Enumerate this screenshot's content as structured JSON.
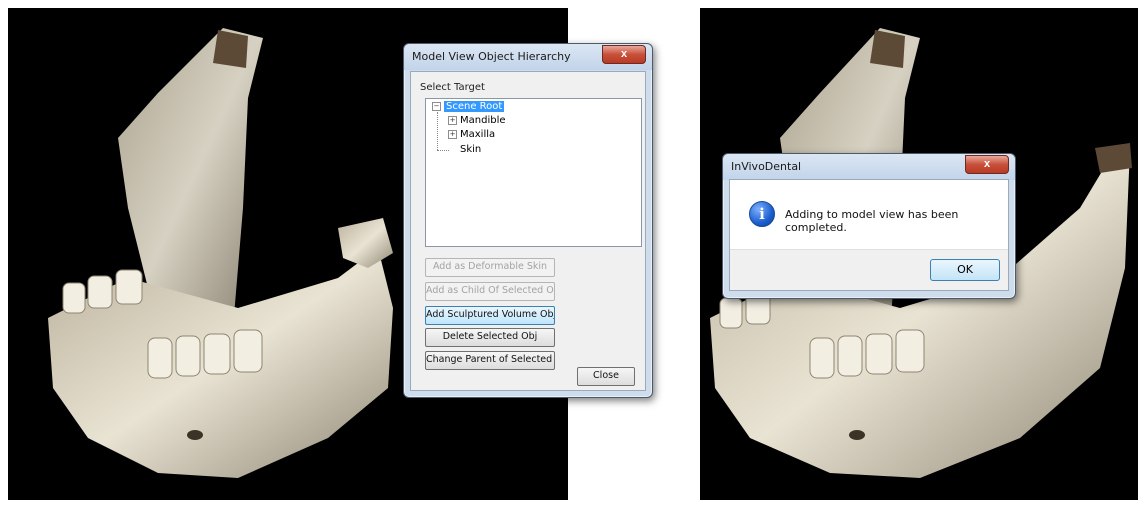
{
  "hierarchy_dialog": {
    "title": "Model View Object Hierarchy",
    "close_glyph": "x",
    "select_target_label": "Select Target",
    "tree": {
      "root": "Scene Root",
      "children": [
        "Mandible",
        "Maxilla",
        "Skin"
      ]
    },
    "buttons": {
      "add_deformable_skin": "Add as Deformable Skin",
      "add_child": "Add as Child Of Selected Obj",
      "add_sculptured": "Add Sculptured Volume Object",
      "delete_selected": "Delete Selected Obj",
      "change_parent": "Change Parent of Selected Obj",
      "close": "Close"
    },
    "expanders": [
      "−",
      "+",
      "+"
    ]
  },
  "message_box": {
    "title": "InVivoDental",
    "close_glyph": "x",
    "icon": "info-icon",
    "icon_glyph": "i",
    "message": "Adding to model view has been completed.",
    "ok": "OK"
  },
  "colors": {
    "viewport_bg": "#000000",
    "bone": "#e8e2d2",
    "close_red": "#c7503a",
    "selection": "#3399ff"
  }
}
